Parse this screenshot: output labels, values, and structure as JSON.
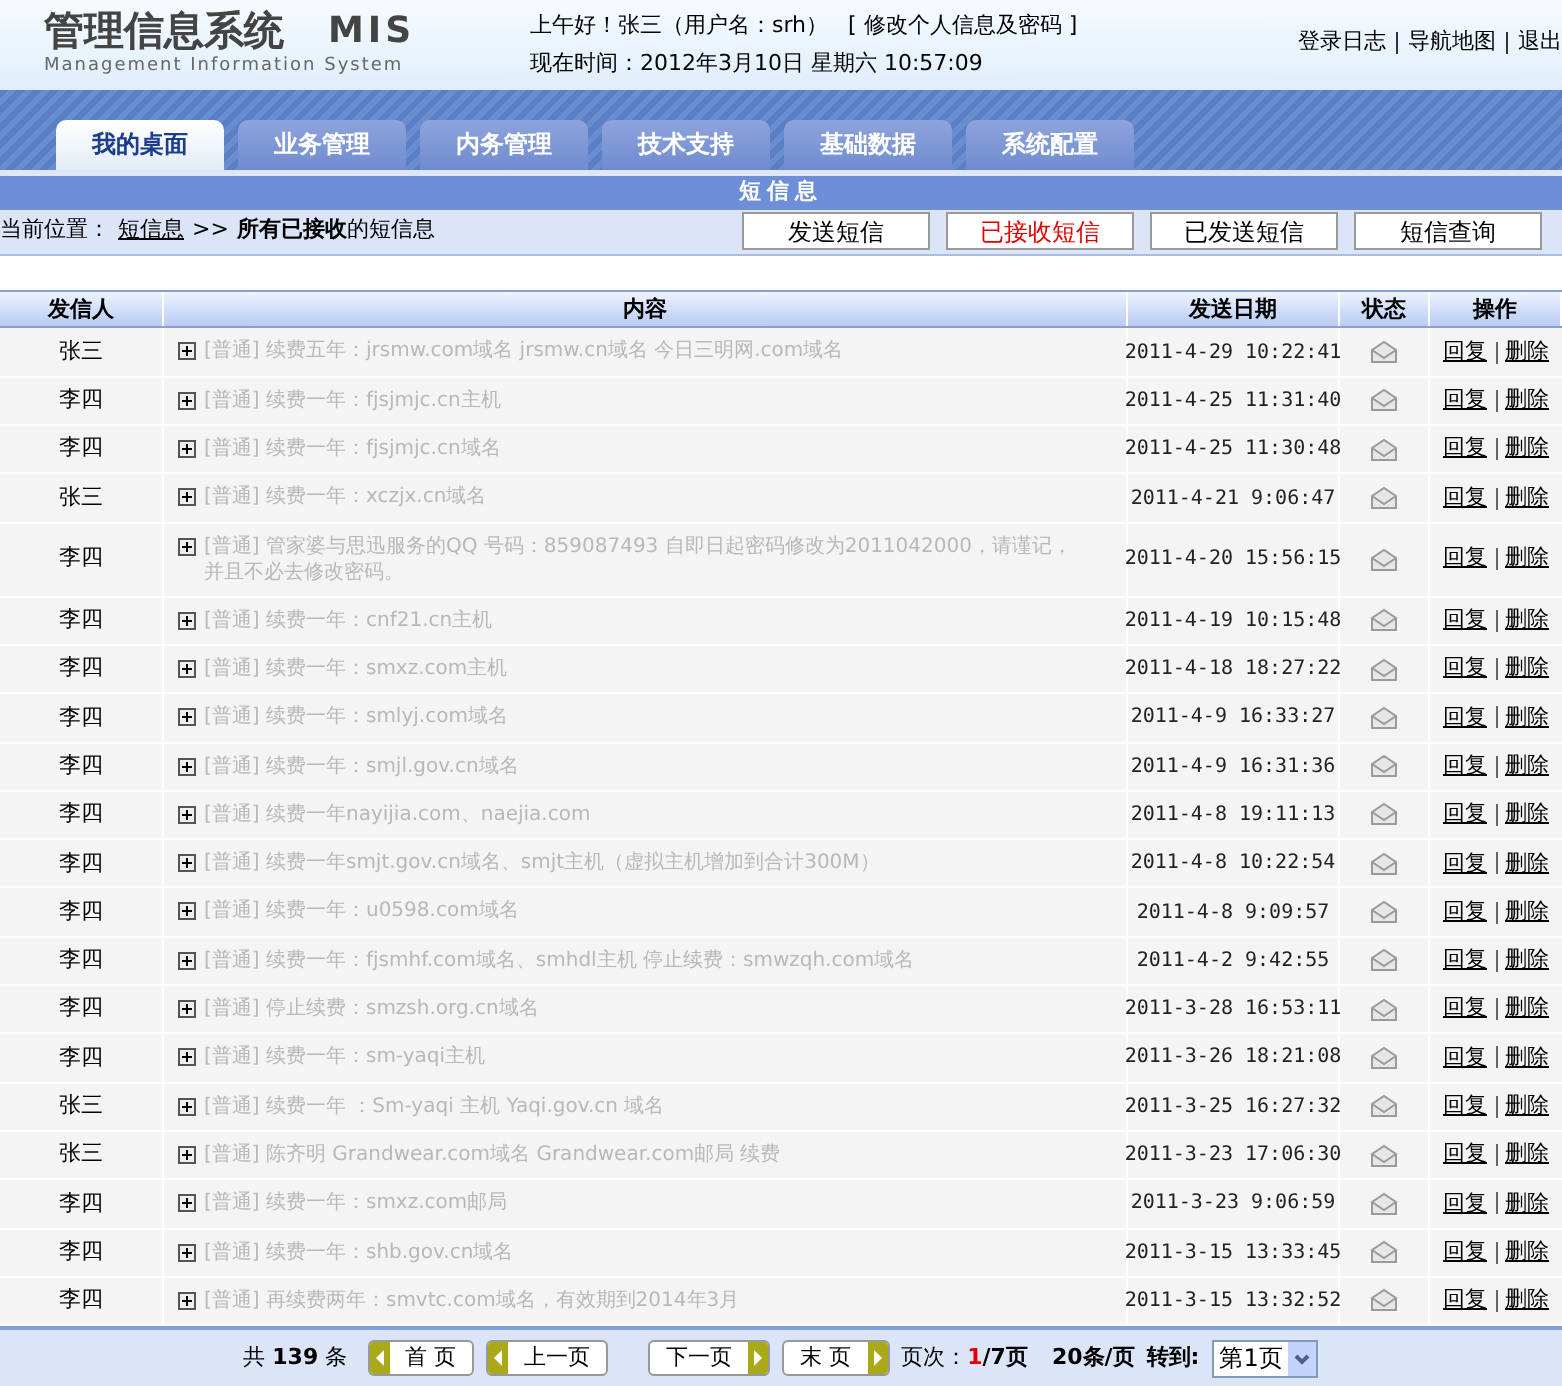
{
  "header": {
    "logo_title": "管理信息系统",
    "logo_abbr": "MIS",
    "logo_subtitle": "Management Information System",
    "greeting": "上午好！张三（用户名：srh）",
    "profile_link": "[ 修改个人信息及密码 ]",
    "current_time": "现在时间：2012年3月10日 星期六  10:57:09",
    "links": [
      "登录日志",
      "导航地图",
      "退出"
    ]
  },
  "tabs": [
    {
      "label": "我的桌面",
      "selected": true
    },
    {
      "label": "业务管理",
      "selected": false
    },
    {
      "label": "内务管理",
      "selected": false
    },
    {
      "label": "技术支持",
      "selected": false
    },
    {
      "label": "基础数据",
      "selected": false
    },
    {
      "label": "系统配置",
      "selected": false
    }
  ],
  "section_title": "短信息",
  "breadcrumb": {
    "label": "当前位置：",
    "link": "短信息",
    "separator": ">>",
    "current": "**所有已接收**的短信息"
  },
  "actions": [
    {
      "label": "发送短信",
      "selected": false
    },
    {
      "label": "已接收短信",
      "selected": true
    },
    {
      "label": "已发送短信",
      "selected": false
    },
    {
      "label": "短信查询",
      "selected": false
    }
  ],
  "table": {
    "columns": [
      "发信人",
      "内容",
      "发送日期",
      "状态",
      "操作"
    ],
    "rows": [
      {
        "sender": "张三",
        "content": "[普通] 续费五年：jrsmw.com域名 jrsmw.cn域名 今日三明网.com域名",
        "date": "2011-4-29 10:22:41",
        "actions": [
          "回复",
          "删除"
        ]
      },
      {
        "sender": "李四",
        "content": "[普通] 续费一年：fjsjmjc.cn主机",
        "date": "2011-4-25 11:31:40",
        "actions": [
          "回复",
          "删除"
        ]
      },
      {
        "sender": "李四",
        "content": "[普通] 续费一年：fjsjmjc.cn域名",
        "date": "2011-4-25 11:30:48",
        "actions": [
          "回复",
          "删除"
        ]
      },
      {
        "sender": "张三",
        "content": "[普通] 续费一年：xczjx.cn域名",
        "date": "2011-4-21 9:06:47",
        "actions": [
          "回复",
          "删除"
        ]
      },
      {
        "sender": "李四",
        "content": "[普通] 管家婆与思迅服务的QQ 号码：859087493 自即日起密码修改为2011042000，请谨记，并且不必去修改密码。",
        "date": "2011-4-20 15:56:15",
        "actions": [
          "回复",
          "删除"
        ]
      },
      {
        "sender": "李四",
        "content": "[普通] 续费一年：cnf21.cn主机",
        "date": "2011-4-19 10:15:48",
        "actions": [
          "回复",
          "删除"
        ]
      },
      {
        "sender": "李四",
        "content": "[普通] 续费一年：smxz.com主机",
        "date": "2011-4-18 18:27:22",
        "actions": [
          "回复",
          "删除"
        ]
      },
      {
        "sender": "李四",
        "content": "[普通] 续费一年：smlyj.com域名",
        "date": "2011-4-9 16:33:27",
        "actions": [
          "回复",
          "删除"
        ]
      },
      {
        "sender": "李四",
        "content": "[普通] 续费一年：smjl.gov.cn域名",
        "date": "2011-4-9 16:31:36",
        "actions": [
          "回复",
          "删除"
        ]
      },
      {
        "sender": "李四",
        "content": "[普通] 续费一年nayijia.com、naejia.com",
        "date": "2011-4-8 19:11:13",
        "actions": [
          "回复",
          "删除"
        ]
      },
      {
        "sender": "李四",
        "content": "[普通] 续费一年smjt.gov.cn域名、smjt主机（虚拟主机增加到合计300M）",
        "date": "2011-4-8 10:22:54",
        "actions": [
          "回复",
          "删除"
        ]
      },
      {
        "sender": "李四",
        "content": "[普通] 续费一年：u0598.com域名",
        "date": "2011-4-8 9:09:57",
        "actions": [
          "回复",
          "删除"
        ]
      },
      {
        "sender": "李四",
        "content": "[普通] 续费一年：fjsmhf.com域名、smhdl主机 停止续费：smwzqh.com域名",
        "date": "2011-4-2 9:42:55",
        "actions": [
          "回复",
          "删除"
        ]
      },
      {
        "sender": "李四",
        "content": "[普通] 停止续费：smzsh.org.cn域名",
        "date": "2011-3-28 16:53:11",
        "actions": [
          "回复",
          "删除"
        ]
      },
      {
        "sender": "李四",
        "content": "[普通] 续费一年：sm-yaqi主机",
        "date": "2011-3-26 18:21:08",
        "actions": [
          "回复",
          "删除"
        ]
      },
      {
        "sender": "张三",
        "content": "[普通] 续费一年 ：Sm-yaqi 主机 Yaqi.gov.cn 域名",
        "date": "2011-3-25 16:27:32",
        "actions": [
          "回复",
          "删除"
        ]
      },
      {
        "sender": "张三",
        "content": "[普通] 陈齐明 Grandwear.com域名 Grandwear.com邮局 续费",
        "date": "2011-3-23 17:06:30",
        "actions": [
          "回复",
          "删除"
        ]
      },
      {
        "sender": "李四",
        "content": "[普通] 续费一年：smxz.com邮局",
        "date": "2011-3-23 9:06:59",
        "actions": [
          "回复",
          "删除"
        ]
      },
      {
        "sender": "李四",
        "content": "[普通] 续费一年：shb.gov.cn域名",
        "date": "2011-3-15 13:33:45",
        "actions": [
          "回复",
          "删除"
        ]
      },
      {
        "sender": "李四",
        "content": "[普通] 再续费两年：smvtc.com域名，有效期到2014年3月",
        "date": "2011-3-15 13:32:52",
        "actions": [
          "回复",
          "删除"
        ]
      }
    ]
  },
  "pagination": {
    "total": "共 **139** 条",
    "buttons": [
      "首 页",
      "上一页",
      "下一页",
      "末 页"
    ],
    "page_label": "页次：",
    "page_current": "1",
    "page_total": "/7页",
    "per_page": "20条/页",
    "goto_label": "转到:",
    "goto_value": "第1页"
  }
}
